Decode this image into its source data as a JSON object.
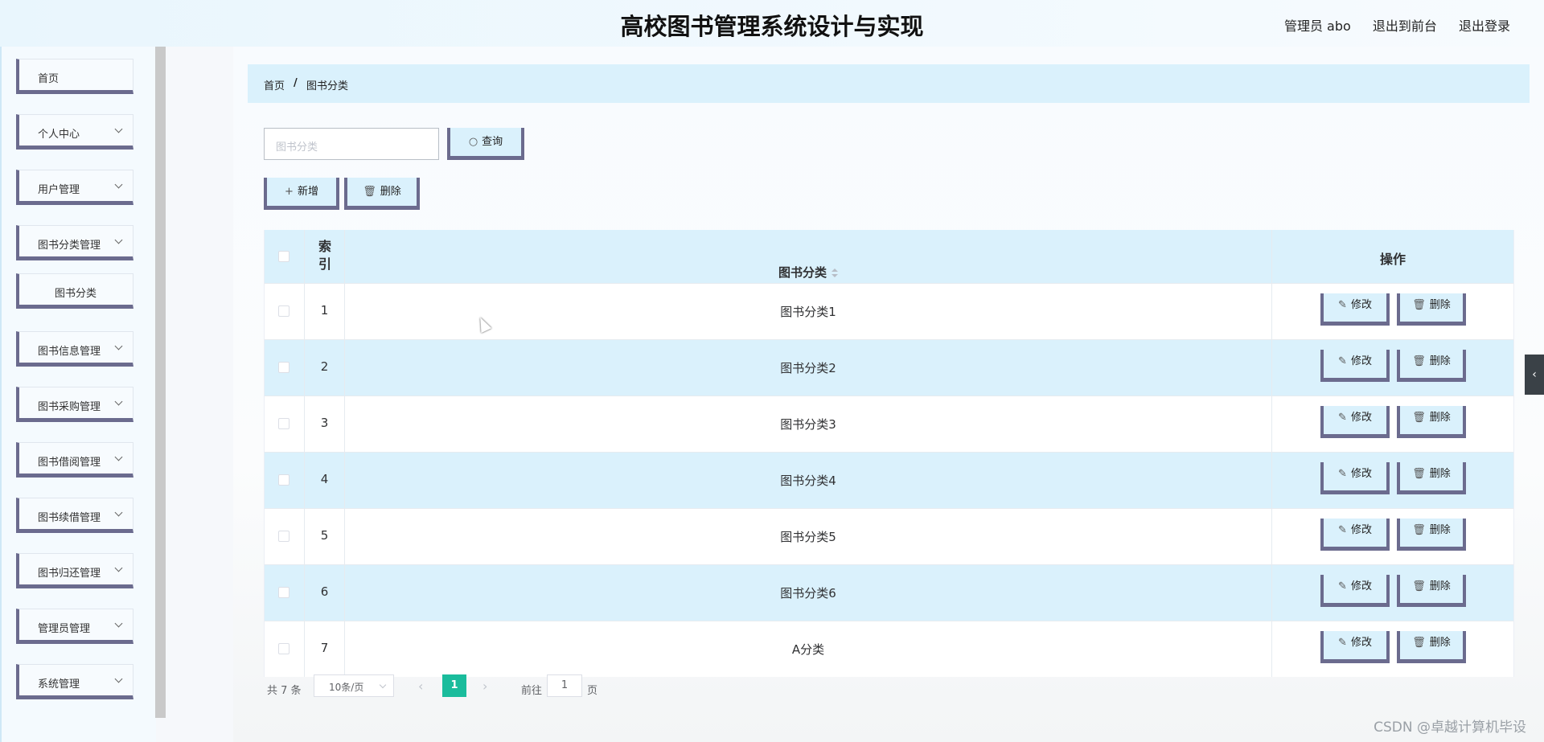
{
  "header": {
    "title": "高校图书管理系统设计与实现",
    "user": "管理员 abo",
    "front_link": "退出到前台",
    "logout_link": "退出登录"
  },
  "sidebar": {
    "items": [
      {
        "label": "首页"
      },
      {
        "label": "个人中心"
      },
      {
        "label": "用户管理"
      },
      {
        "label": "图书分类管理"
      },
      {
        "label": "图书分类"
      },
      {
        "label": "图书信息管理"
      },
      {
        "label": "图书采购管理"
      },
      {
        "label": "图书借阅管理"
      },
      {
        "label": "图书续借管理"
      },
      {
        "label": "图书归还管理"
      },
      {
        "label": "管理员管理"
      },
      {
        "label": "系统管理"
      }
    ]
  },
  "breadcrumb": {
    "home": "首页",
    "sep": "/",
    "current": "图书分类"
  },
  "search": {
    "placeholder": "图书分类",
    "button": "查询",
    "icon": "search-icon"
  },
  "toolbar": {
    "add": "新增",
    "delete": "删除"
  },
  "table": {
    "headers": {
      "index": "索引",
      "name": "图书分类",
      "ops": "操作"
    },
    "edit_label": "修改",
    "delete_label": "删除",
    "rows": [
      {
        "index": "1",
        "name": "图书分类1"
      },
      {
        "index": "2",
        "name": "图书分类2"
      },
      {
        "index": "3",
        "name": "图书分类3"
      },
      {
        "index": "4",
        "name": "图书分类4"
      },
      {
        "index": "5",
        "name": "图书分类5"
      },
      {
        "index": "6",
        "name": "图书分类6"
      },
      {
        "index": "7",
        "name": "A分类"
      }
    ]
  },
  "pagination": {
    "total": "共 7 条",
    "page_size": "10条/页",
    "current_page": "1",
    "goto_label": "前往",
    "goto_value": "1",
    "page_suffix": "页"
  },
  "watermark": "CSDN @卓越计算机毕设",
  "colors": {
    "accent": "#daf1fc",
    "border3d": "#6b6b8e",
    "page_active": "#1abc9c"
  }
}
